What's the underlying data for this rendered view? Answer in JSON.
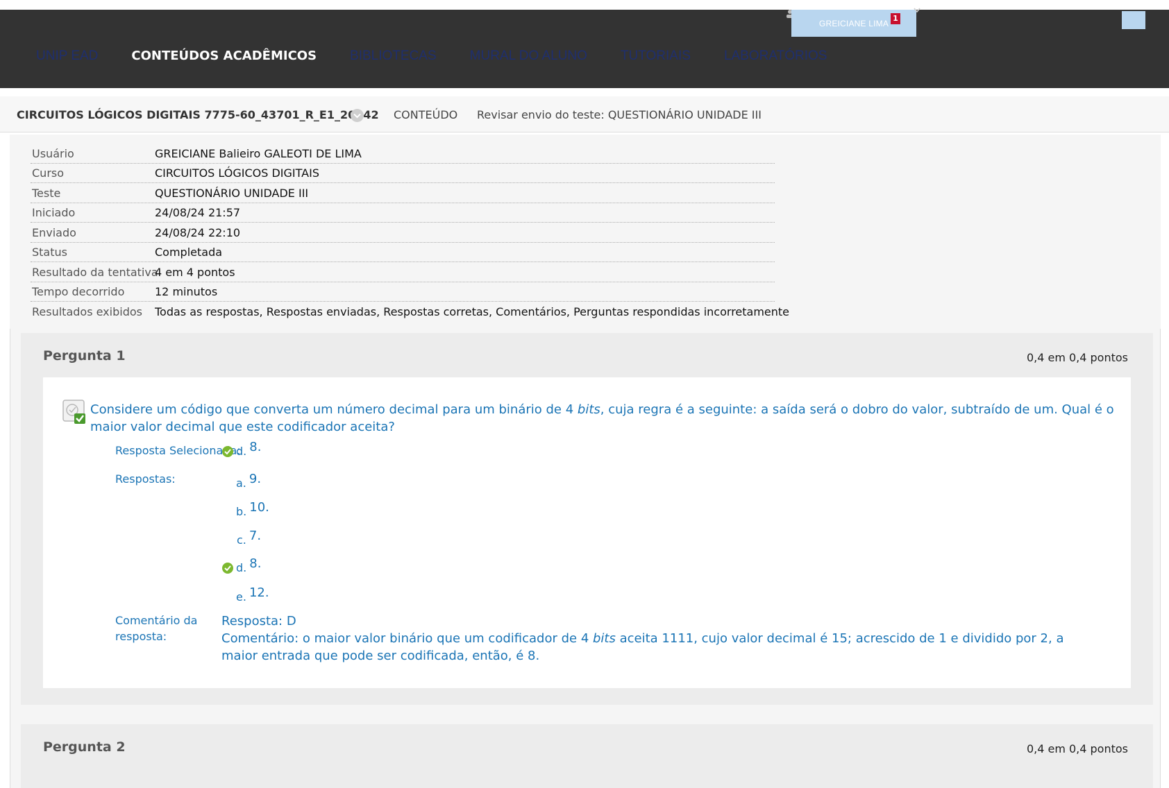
{
  "nav": {
    "tabs": [
      "UNIP EAD",
      "CONTEÚDOS ACADÊMICOS",
      "BIBLIOTECAS",
      "MURAL DO ALUNO",
      "TUTORIAIS",
      "LABORATÓRIOS"
    ],
    "user_name": "GREICIANE LIMA",
    "notification_count": "1"
  },
  "breadcrumb": {
    "course": "CIRCUITOS LÓGICOS DIGITAIS 7775-60_43701_R_E1_20242",
    "section": "CONTEÚDO",
    "page": "Revisar envio do teste: QUESTIONÁRIO UNIDADE III"
  },
  "info": [
    {
      "label": "Usuário",
      "value": "GREICIANE Balieiro GALEOTI DE LIMA"
    },
    {
      "label": "Curso",
      "value": "CIRCUITOS LÓGICOS DIGITAIS"
    },
    {
      "label": "Teste",
      "value": "QUESTIONÁRIO UNIDADE III"
    },
    {
      "label": "Iniciado",
      "value": "24/08/24 21:57"
    },
    {
      "label": "Enviado",
      "value": "24/08/24 22:10"
    },
    {
      "label": "Status",
      "value": "Completada"
    },
    {
      "label": "Resultado da tentativa",
      "value": "4 em 4 pontos"
    },
    {
      "label": "Tempo decorrido",
      "value": "12 minutos"
    },
    {
      "label": "Resultados exibidos",
      "value": "Todas as respostas, Respostas enviadas, Respostas corretas, Comentários, Perguntas respondidas incorretamente"
    }
  ],
  "questions": [
    {
      "title": "Pergunta 1",
      "points": "0,4 em 0,4 pontos",
      "text_before": "Considere um código que converta um número decimal para um binário de 4 ",
      "text_italic": "bits",
      "text_after": ", cuja regra é a seguinte: a saída será o dobro do valor, subtraído de um. Qual é o maior valor decimal que este codificador aceita?",
      "selected_label": "Resposta Selecionada:",
      "selected_letter": "d.",
      "selected_text": "8.",
      "answers_label": "Respostas:",
      "answers": [
        {
          "letter": "a.",
          "text": "9.",
          "correct": false
        },
        {
          "letter": "b.",
          "text": "10.",
          "correct": false
        },
        {
          "letter": "c.",
          "text": "7.",
          "correct": false
        },
        {
          "letter": "d.",
          "text": "8.",
          "correct": true
        },
        {
          "letter": "e.",
          "text": "12.",
          "correct": false
        }
      ],
      "comment_label_1": "Comentário da",
      "comment_label_2": "resposta:",
      "comment_answer": "Resposta: D",
      "comment_before": "Comentário: o maior valor binário que um codificador de 4 ",
      "comment_italic": "bits",
      "comment_after": " aceita 1111, cujo valor decimal é 15; acrescido de 1 e dividido por 2, a maior entrada que pode ser codificada, então, é 8."
    },
    {
      "title": "Pergunta 2",
      "points": "0,4 em 0,4 pontos"
    }
  ],
  "colors": {
    "nav_bg": "#333333",
    "link_blue": "#1a74b5",
    "badge_red": "#c8102e",
    "check_green": "#7cb82f",
    "panel_bg": "#ececec"
  }
}
